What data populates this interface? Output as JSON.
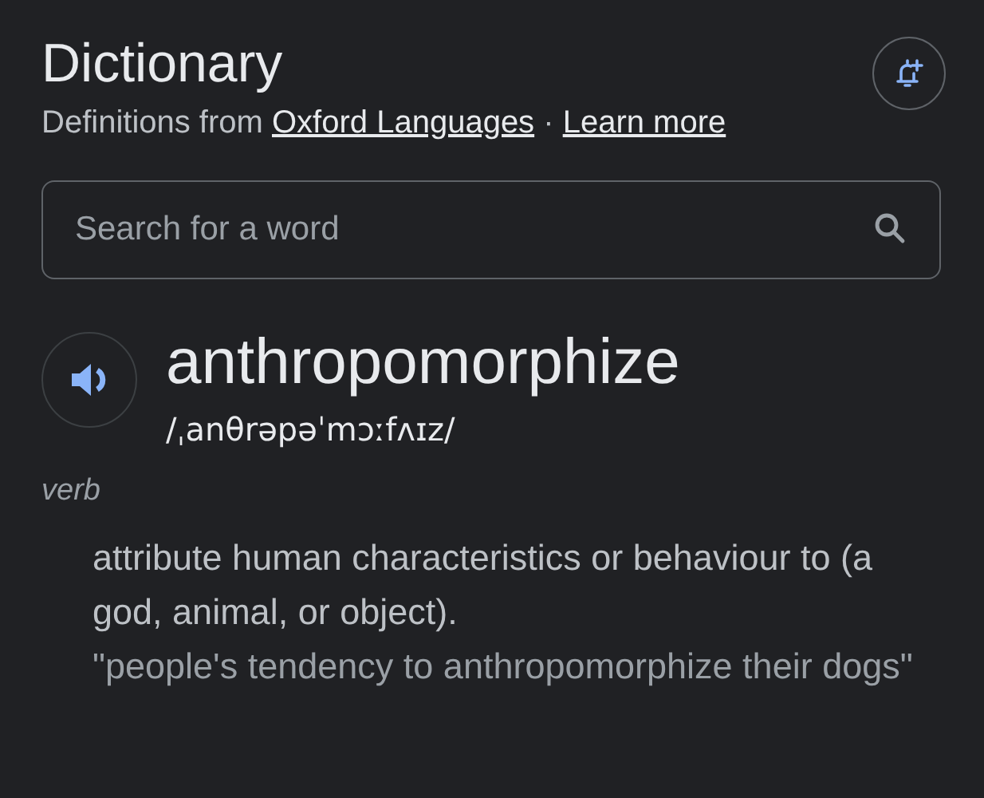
{
  "title": "Dictionary",
  "source": {
    "prefix": "Definitions from",
    "links": [
      "Oxford Languages",
      "Learn more"
    ],
    "separator": "·"
  },
  "search": {
    "placeholder": "Search for a word"
  },
  "entry": {
    "word": "anthropomorphize",
    "phonetic": "/ˌanθrəpəˈmɔːfʌɪz/",
    "part_of_speech": "verb",
    "definitions": [
      {
        "text": "attribute human characteristics or behaviour to (a god, animal, or object).",
        "example": "\"people's tendency to anthropomorphize their dogs\""
      }
    ]
  }
}
